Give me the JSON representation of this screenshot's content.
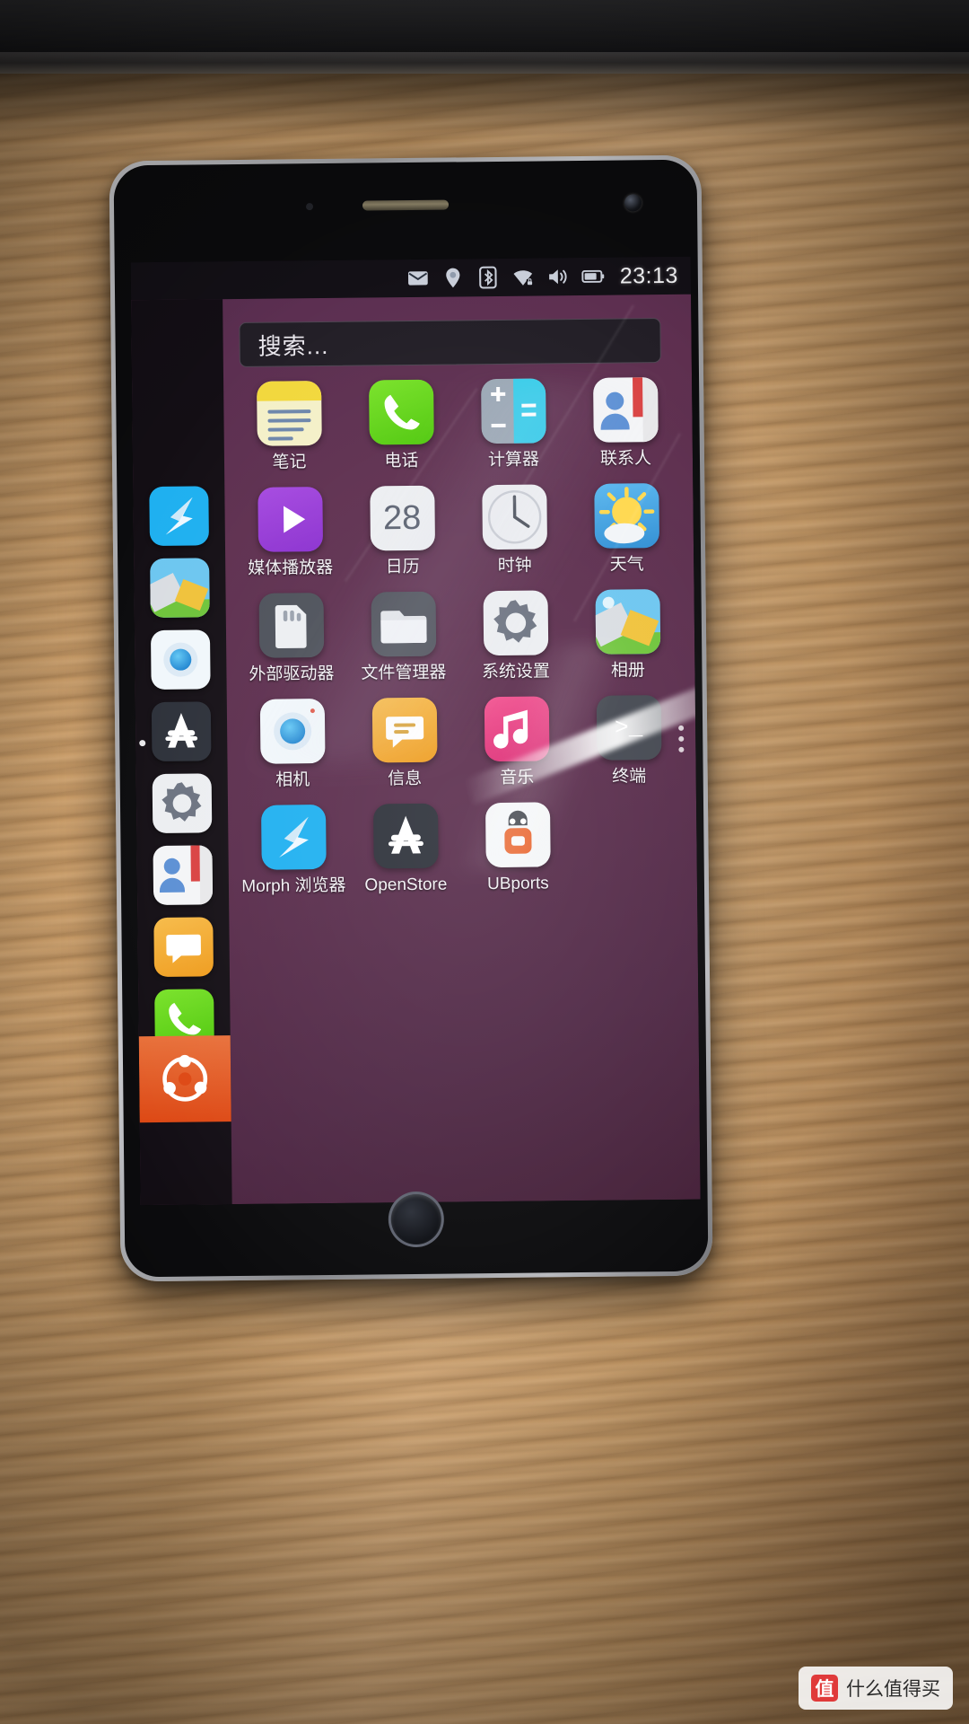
{
  "device": {
    "platform": "Ubuntu Touch",
    "shell": "app-drawer"
  },
  "statusbar": {
    "icons": [
      {
        "name": "mail-icon",
        "glyph": "envelope"
      },
      {
        "name": "location-icon",
        "glyph": "pin"
      },
      {
        "name": "bluetooth-icon",
        "glyph": "bluetooth"
      },
      {
        "name": "wifi-icon",
        "glyph": "wifi"
      },
      {
        "name": "volume-icon",
        "glyph": "speaker"
      },
      {
        "name": "battery-icon",
        "glyph": "battery"
      }
    ],
    "time": "23:13"
  },
  "search": {
    "placeholder": "搜索..."
  },
  "apps": [
    {
      "label": "笔记",
      "icon": "notes-icon"
    },
    {
      "label": "电话",
      "icon": "phone-icon"
    },
    {
      "label": "计算器",
      "icon": "calculator-icon"
    },
    {
      "label": "联系人",
      "icon": "contacts-icon"
    },
    {
      "label": "媒体播放器",
      "icon": "media-player-icon"
    },
    {
      "label": "日历",
      "icon": "calendar-icon"
    },
    {
      "label": "时钟",
      "icon": "clock-icon"
    },
    {
      "label": "天气",
      "icon": "weather-icon"
    },
    {
      "label": "外部驱动器",
      "icon": "external-drive-icon"
    },
    {
      "label": "文件管理器",
      "icon": "file-manager-icon"
    },
    {
      "label": "系统设置",
      "icon": "system-settings-icon"
    },
    {
      "label": "相册",
      "icon": "gallery-icon"
    },
    {
      "label": "相机",
      "icon": "camera-icon"
    },
    {
      "label": "信息",
      "icon": "messages-icon"
    },
    {
      "label": "音乐",
      "icon": "music-icon"
    },
    {
      "label": "终端",
      "icon": "terminal-icon"
    },
    {
      "label": "Morph 浏览器",
      "icon": "morph-browser-icon"
    },
    {
      "label": "OpenStore",
      "icon": "openstore-icon"
    },
    {
      "label": "UBports",
      "icon": "ubports-icon"
    }
  ],
  "calendar_day": "28",
  "launcher": {
    "items": [
      {
        "name": "dock-item-morph-browser",
        "icon": "morph-browser-icon"
      },
      {
        "name": "dock-item-gallery",
        "icon": "gallery-icon"
      },
      {
        "name": "dock-item-camera",
        "icon": "camera-icon"
      },
      {
        "name": "dock-item-openstore",
        "icon": "openstore-icon"
      },
      {
        "name": "dock-item-settings",
        "icon": "system-settings-icon"
      },
      {
        "name": "dock-item-contacts",
        "icon": "contacts-icon"
      },
      {
        "name": "dock-item-messages",
        "icon": "messages-icon"
      },
      {
        "name": "dock-item-phone",
        "icon": "phone-icon"
      }
    ],
    "home_label": "ubuntu-logo-icon"
  },
  "watermark": {
    "badge": "值",
    "text": "什么值得买"
  },
  "colors": {
    "desktop_purple": "#5b2f52",
    "ubuntu_orange": "#dd4814",
    "statusbar": "#131016",
    "notes_yellow": "#f2d83c",
    "phone_green": "#5fd91b",
    "calc_cyan": "#37cdea",
    "music_pink": "#ec3d7e",
    "messages_orange": "#f5a623"
  }
}
